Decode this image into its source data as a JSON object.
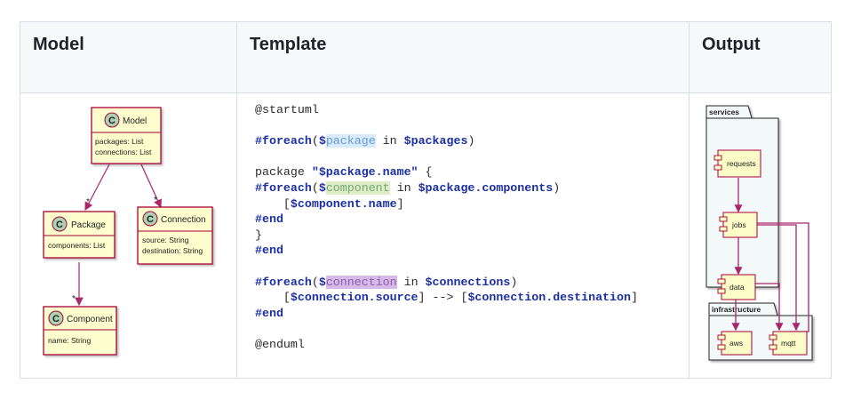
{
  "headers": {
    "model": "Model",
    "template": "Template",
    "output": "Output"
  },
  "model_diagram": {
    "classes": [
      {
        "id": "model",
        "name": "Model",
        "fields": [
          "packages: List",
          "connections: List"
        ]
      },
      {
        "id": "package",
        "name": "Package",
        "fields": [
          "components: List"
        ]
      },
      {
        "id": "connection",
        "name": "Connection",
        "fields": [
          "source: String",
          "destination: String"
        ]
      },
      {
        "id": "component",
        "name": "Component",
        "fields": [
          "name: String"
        ]
      }
    ],
    "multiplicity": "*",
    "class_badge": "C"
  },
  "template": {
    "startuml": "@startuml",
    "foreach_kw": "#foreach",
    "in_kw": "in",
    "end_kw": "#end",
    "package_kw": "package",
    "enduml": "@enduml",
    "var_package": "package",
    "var_packages": "$packages",
    "package_name": "\"$package.name\"",
    "var_component": "component",
    "package_components": "$package.components",
    "component_name": "$component.name",
    "var_connection": "connection",
    "var_connections": "$connections",
    "connection_source": "$connection.source",
    "arrow": "-->",
    "connection_destination": "$connection.destination"
  },
  "output_diagram": {
    "packages": [
      {
        "name": "services",
        "components": [
          "requests",
          "jobs",
          "data"
        ]
      },
      {
        "name": "infrastructure",
        "components": [
          "aws",
          "mqtt"
        ]
      }
    ]
  },
  "colors": {
    "arrow": "#a8266a",
    "class_bg": "#fefece",
    "class_border": "#a80036",
    "badge": "#add1b2",
    "package_bg": "#f3f8f8",
    "component_bg": "#fcfcc9"
  }
}
